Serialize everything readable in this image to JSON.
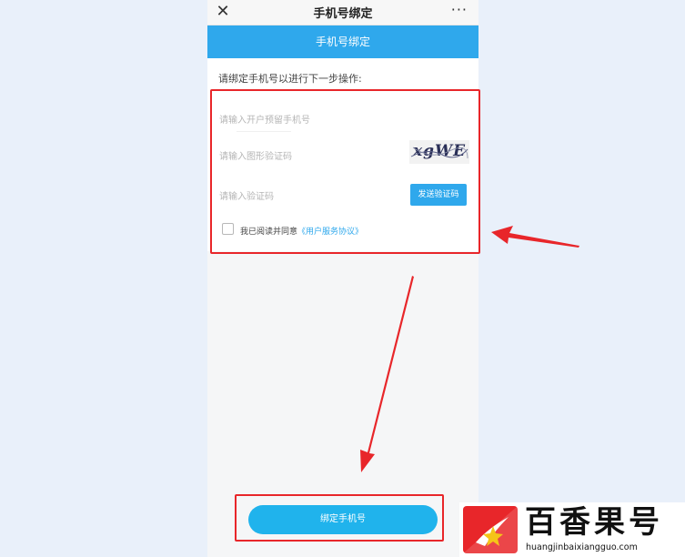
{
  "topbar": {
    "close_glyph": "✕",
    "title": "手机号绑定",
    "more_glyph": "···"
  },
  "header": {
    "title": "手机号绑定"
  },
  "form": {
    "instruction": "请绑定手机号以进行下一步操作:",
    "phone_placeholder": "请输入开户预留手机号",
    "captcha_placeholder": "请输入图形验证码",
    "captcha_image_text": "xgWE",
    "code_placeholder": "请输入验证码",
    "send_code_label": "发送验证码",
    "agree_text": "我已阅读并同意",
    "agree_link": "《用户服务协议》"
  },
  "footer": {
    "bind_button_label": "绑定手机号"
  },
  "watermark": {
    "brand": "百香果号",
    "url": "huangjinbaixiangguo.com"
  },
  "colors": {
    "accent": "#2fa8ec",
    "highlight": "#e8262a",
    "background": "#e9f0fa"
  }
}
